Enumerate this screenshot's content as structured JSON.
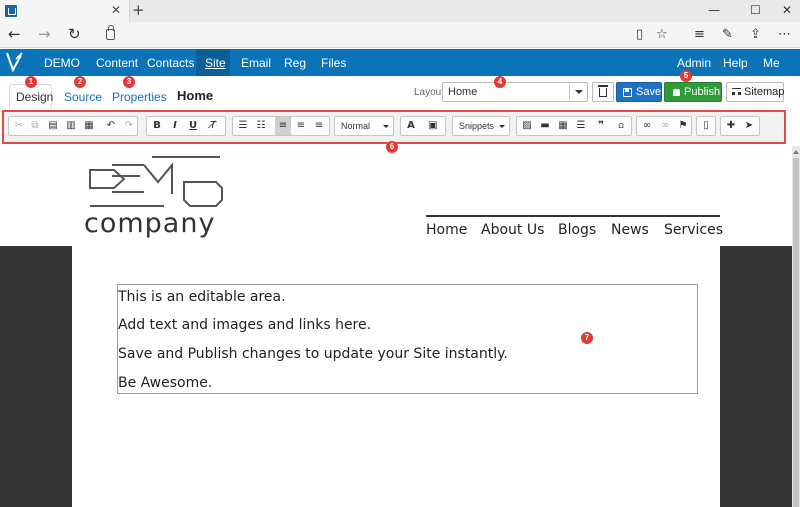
{
  "browser": {
    "tab_title": "",
    "icons": {
      "back": "back-arrow-icon",
      "forward": "forward-arrow-icon",
      "refresh": "refresh-icon",
      "lock": "lock-icon",
      "reading_view": "book-icon",
      "favorite": "star-icon",
      "hub": "hub-icon",
      "notes": "pen-icon",
      "share": "share-icon",
      "more": "more-icon"
    }
  },
  "appnav": {
    "items": [
      "DEMO",
      "Content",
      "Contacts",
      "Site",
      "Email",
      "Reg",
      "Files"
    ],
    "right_items": [
      "Admin",
      "Help",
      "Me"
    ],
    "active": "Site",
    "color": "#0b74b8"
  },
  "editor": {
    "tabs": [
      "Design",
      "Source",
      "Properties"
    ],
    "page_name": "Home",
    "layout_label": "Layout",
    "layout_value": "Home",
    "save_label": "Save",
    "publish_label": "Publish",
    "sitemap_label": "Sitemap"
  },
  "toolbar": {
    "format_value": "Normal",
    "snippets_label": "Snippets"
  },
  "site": {
    "logo_text": "company",
    "nav": [
      "Home",
      "About Us",
      "Blogs",
      "News",
      "Services"
    ],
    "editable_lines": [
      "This is an editable area.",
      "Add text and images and links here.",
      "Save and Publish changes to update your Site instantly.",
      "Be Awesome."
    ]
  },
  "callouts": [
    "1",
    "2",
    "3",
    "4",
    "5",
    "6",
    "7"
  ],
  "colors": {
    "accent": "#0b74b8",
    "publish": "#2e9c3a",
    "save": "#1f73c4",
    "callout": "#e53935"
  }
}
